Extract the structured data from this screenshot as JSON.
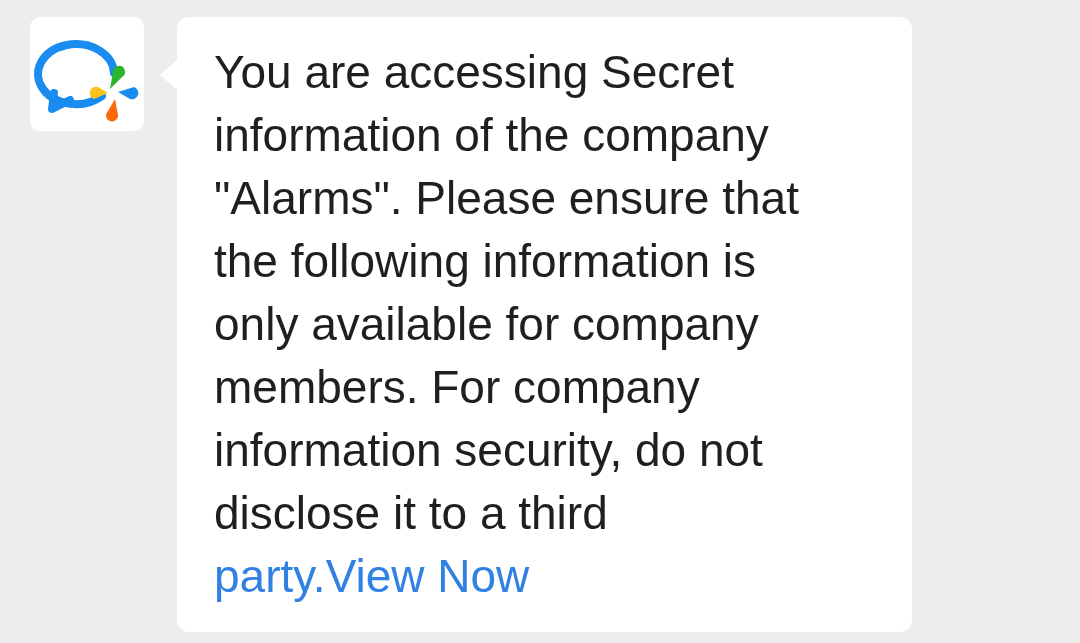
{
  "message": {
    "text": "You are accessing Secret information of the company \"Alarms\". Please ensure that the following information is only available for company members. For company information security, do not disclose it to a third",
    "link": "party.View Now"
  }
}
